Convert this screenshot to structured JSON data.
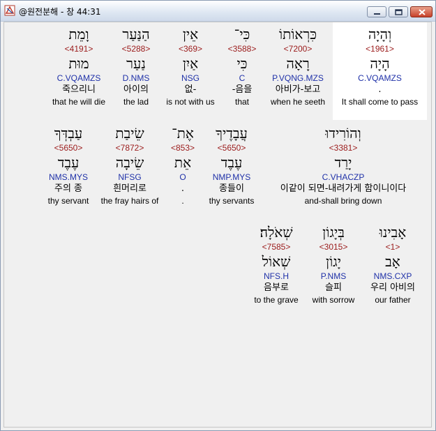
{
  "window": {
    "title": "@원전분해 - 창 44:31"
  },
  "words": [
    {
      "hebrew": "וְהָיָה",
      "strong": "<1961>",
      "root": "הָיָה",
      "morph": "C.VQAMZS",
      "korean": ".",
      "english": "It shall come to pass",
      "highlighted": true
    },
    {
      "hebrew": "כִּרְאוֹתוֹ",
      "strong": "<7200>",
      "root": "רָאָה",
      "morph": "P.VQNG.MZS",
      "korean": "아비가-보고",
      "english": "when he seeth"
    },
    {
      "hebrew": "כִּי־",
      "strong": "<3588>",
      "root": "כִּי",
      "morph": "C",
      "korean": "-음을",
      "english": "that"
    },
    {
      "hebrew": "אֵין",
      "strong": "<369>",
      "root": "אַיִן",
      "morph": "NSG",
      "korean": "없-",
      "english": "is not with us"
    },
    {
      "hebrew": "הַנַּעַר",
      "strong": "<5288>",
      "root": "נַעַר",
      "morph": "D.NMS",
      "korean": "아이의",
      "english": "the lad"
    },
    {
      "hebrew": "וָמֵת",
      "strong": "<4191>",
      "root": "מוּת",
      "morph": "C.VQAMZS",
      "korean": "죽으리니",
      "english": "that he will die"
    },
    {
      "hebrew": "וְהוֹרִידוּ",
      "strong": "<3381>",
      "root": "יָרַד",
      "morph": "C.VHACZP",
      "korean": "이같이 되면-내려가게 함이니이다",
      "english": "and-shall bring down"
    },
    {
      "hebrew": "עֲבָדֶיךָ",
      "strong": "<5650>",
      "root": "עֶבֶד",
      "morph": "NMP.MYS",
      "korean": "종들이",
      "english": "thy servants"
    },
    {
      "hebrew": "אֶת־",
      "strong": "<853>",
      "root": "אֵת",
      "morph": "O",
      "korean": ".",
      "english": "."
    },
    {
      "hebrew": "שֵׂיבַת",
      "strong": "<7872>",
      "root": "שֵׂיבָה",
      "morph": "NFSG",
      "korean": "흰머리로",
      "english": "the fray hairs of"
    },
    {
      "hebrew": "עַבְדְּךָ",
      "strong": "<5650>",
      "root": "עֶבֶד",
      "morph": "NMS.MYS",
      "korean": "주의 종",
      "english": "thy servant"
    },
    {
      "hebrew": "אָבִינוּ",
      "strong": "<1>",
      "root": "אָב",
      "morph": "NMS.CXP",
      "korean": "우리 아비의",
      "english": "our father"
    },
    {
      "hebrew": "בְּיָגוֹן",
      "strong": "<3015>",
      "root": "יָגוֹן",
      "morph": "P.NMS",
      "korean": "슬피",
      "english": "with sorrow"
    },
    {
      "hebrew": "שְׁאֹלָה׃",
      "strong": "<7585>",
      "root": "שְׁאוֹל",
      "morph": "NFS.H",
      "korean": "음부로",
      "english": "to the grave"
    }
  ]
}
